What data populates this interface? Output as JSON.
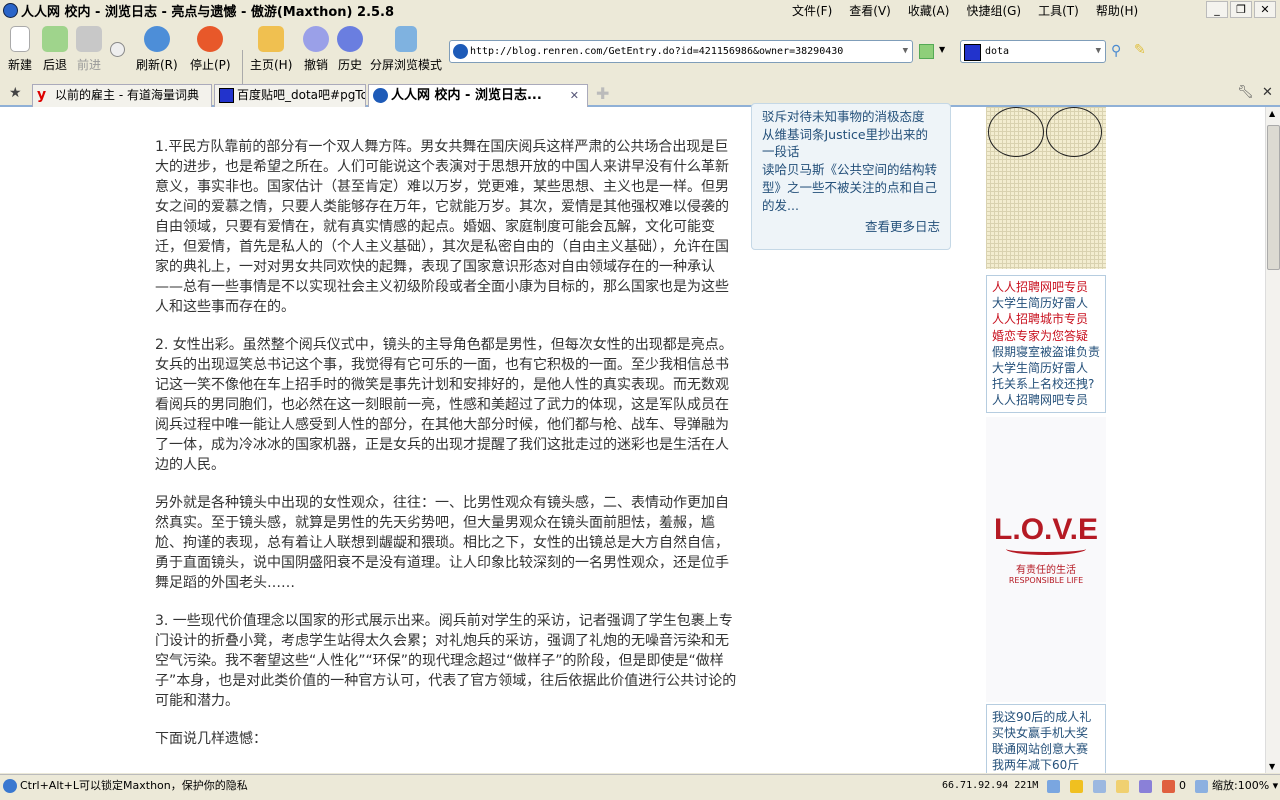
{
  "window": {
    "title": "人人网 校内 - 浏览日志 - 亮点与遗憾 - 傲游(Maxthon) 2.5.8"
  },
  "menu": [
    "文件(F)",
    "查看(V)",
    "收藏(A)",
    "快捷组(G)",
    "工具(T)",
    "帮助(H)"
  ],
  "toolbar": {
    "new": "新建",
    "back": "后退",
    "forward": "前进",
    "refresh": "刷新(R)",
    "stop": "停止(P)",
    "home": "主页(H)",
    "undo": "撤销",
    "history": "历史",
    "split": "分屏浏览模式"
  },
  "address": {
    "url": "http://blog.renren.com/GetEntry.do?id=421156986&owner=38290430"
  },
  "search": {
    "value": "dota"
  },
  "tabs": [
    {
      "label": "以前的雇主 - 有道海量词典"
    },
    {
      "label": "百度贴吧_dota吧#pgTop"
    },
    {
      "label": "人人网 校内 - 浏览日志..."
    }
  ],
  "article": {
    "paragraphs": [
      "1.平民方队靠前的部分有一个双人舞方阵。男女共舞在国庆阅兵这样严肃的公共场合出现是巨大的进步，也是希望之所在。人们可能说这个表演对于思想开放的中国人来讲早没有什么革新意义，事实非也。国家估计（甚至肯定）难以万岁，党更难，某些思想、主义也是一样。但男女之间的爱慕之情，只要人类能够存在万年，它就能万岁。其次，爱情是其他强权难以侵袭的自由领域，只要有爱情在，就有真实情感的起点。婚姻、家庭制度可能会瓦解，文化可能变迁，但爱情，首先是私人的（个人主义基础），其次是私密自由的（自由主义基础），允许在国家的典礼上，一对对男女共同欢快的起舞，表现了国家意识形态对自由领域存在的一种承认——总有一些事情是不以实现社会主义初级阶段或者全面小康为目标的，那么国家也是为这些人和这些事而存在的。",
      "2. 女性出彩。虽然整个阅兵仪式中，镜头的主导角色都是男性，但每次女性的出现都是亮点。女兵的出现逗笑总书记这个事，我觉得有它可乐的一面，也有它积极的一面。至少我相信总书记这一笑不像他在车上招手时的微笑是事先计划和安排好的，是他人性的真实表现。而无数观看阅兵的男同胞们，也必然在这一刻眼前一亮，性感和美超过了武力的体现，这是军队成员在阅兵过程中唯一能让人感受到人性的部分，在其他大部分时候，他们都与枪、战车、导弹融为了一体，成为冷冰冰的国家机器，正是女兵的出现才提醒了我们这批走过的迷彩也是生活在人边的人民。",
      "另外就是各种镜头中出现的女性观众，往往：一、比男性观众有镜头感，二、表情动作更加自然真实。至于镜头感，就算是男性的先天劣势吧，但大量男观众在镜头面前胆怯，羞赧，尴尬、拘谨的表现，总有着让人联想到龌龊和猥琐。相比之下，女性的出镜总是大方自然自信，勇于直面镜头，说中国阴盛阳衰不是没有道理。让人印象比较深刻的一名男性观众，还是位手舞足蹈的外国老头……",
      "3. 一些现代价值理念以国家的形式展示出来。阅兵前对学生的采访，记者强调了学生包裹上专门设计的折叠小凳，考虑学生站得太久会累；对礼炮兵的采访，强调了礼炮的无噪音污染和无空气污染。我不奢望这些“人性化”“环保”的现代理念超过“做样子”的阶段，但是即使是“做样子”本身，也是对此类价值的一种官方认可，代表了官方领域，往后依据此价值进行公共讨论的可能和潜力。",
      "下面说几样遗憾："
    ]
  },
  "sidebar": {
    "entries": [
      "驳斥对待未知事物的消极态度",
      "从维基词条Justice里抄出来的一段话",
      "读哈贝马斯《公共空间的结构转型》之一些不被关注的点和自己的发..."
    ],
    "more": "查看更多日志"
  },
  "ads": [
    {
      "text": "人人招聘网吧专员",
      "red": true
    },
    {
      "text": "大学生简历好雷人",
      "red": false
    },
    {
      "text": "人人招聘城市专员",
      "red": true
    },
    {
      "text": "婚恋专家为您答疑",
      "red": true
    },
    {
      "text": "假期寝室被盗谁负责",
      "red": false
    },
    {
      "text": "大学生简历好雷人",
      "red": false
    },
    {
      "text": "托关系上名校还拽?",
      "red": false
    },
    {
      "text": "人人招聘网吧专员",
      "red": false
    }
  ],
  "love_ad": {
    "logo": "L.O.V.E",
    "cn": "有责任的生活",
    "en": "RESPONSIBLE LIFE"
  },
  "ads2": [
    "我这90后的成人礼",
    "买快女赢手机大奖",
    "联通网站创意大赛",
    "我两年减下60斤"
  ],
  "status": {
    "message": "Ctrl+Alt+L可以锁定Maxthon，保护你的隐私",
    "ip": "66.71.92.94 221M",
    "count": "0",
    "zoom": "缩放:100% ▾"
  }
}
